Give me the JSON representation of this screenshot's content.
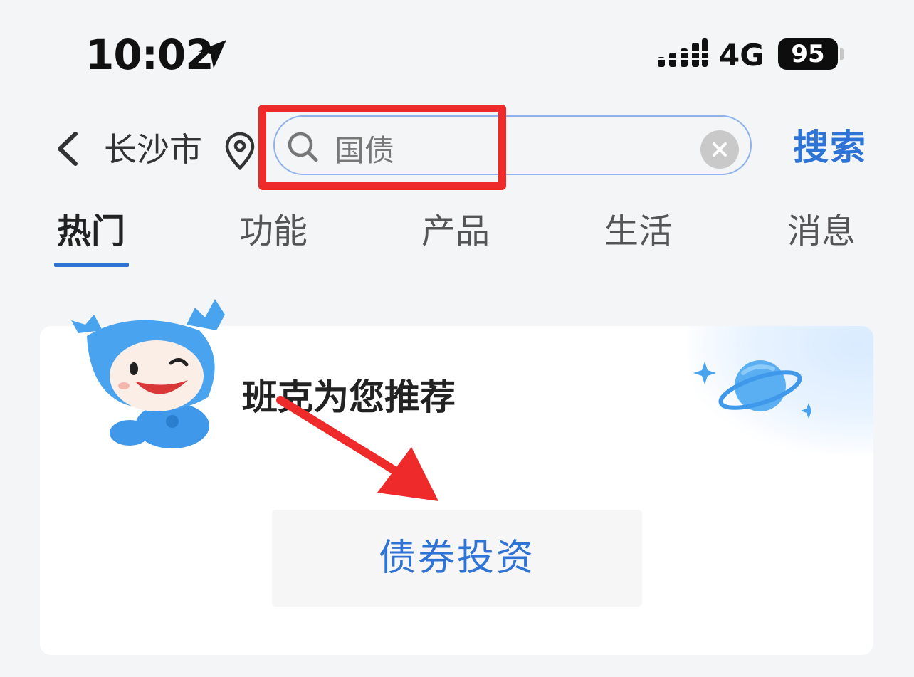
{
  "status_bar": {
    "time": "10:02",
    "network": "4G",
    "battery": "95"
  },
  "header": {
    "city": "长沙市",
    "search_value": "国债",
    "search_button": "搜索"
  },
  "tabs": [
    {
      "label": "热门",
      "active": true
    },
    {
      "label": "功能",
      "active": false
    },
    {
      "label": "产品",
      "active": false
    },
    {
      "label": "生活",
      "active": false
    },
    {
      "label": "消息",
      "active": false
    }
  ],
  "card": {
    "title": "班克为您推荐",
    "recommendation": "债券投资"
  },
  "colors": {
    "accent": "#2e73d6",
    "annotation": "#ee2a2a"
  }
}
